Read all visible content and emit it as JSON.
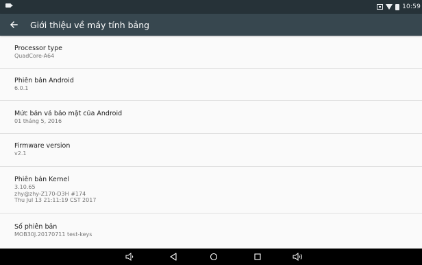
{
  "status_bar": {
    "time": "10:59",
    "icons": [
      "notification-icon",
      "sim-icon",
      "wifi-icon",
      "battery-icon"
    ]
  },
  "app_bar": {
    "back_icon": "arrow-back-icon",
    "title": "Giới thiệu về máy tính bảng"
  },
  "items": [
    {
      "title": "Processor type",
      "lines": [
        "QuadCore-A64"
      ]
    },
    {
      "title": "Phiên bản Android",
      "lines": [
        "6.0.1"
      ]
    },
    {
      "title": "Mức bản vá bảo mật của Android",
      "lines": [
        "01 tháng 5, 2016"
      ]
    },
    {
      "title": "Firmware version",
      "lines": [
        "v2.1"
      ]
    },
    {
      "title": "Phiên bản Kernel",
      "lines": [
        "3.10.65",
        "zhy@zhy-Z170-D3H #174",
        "Thu Jul 13 21:11:19 CST 2017"
      ]
    },
    {
      "title": "Số phiên bản",
      "lines": [
        "MOB30J.20170711 test-keys"
      ]
    }
  ],
  "nav_bar": {
    "buttons": [
      "volume-down-icon",
      "back-triangle-icon",
      "home-circle-icon",
      "recents-square-icon",
      "volume-up-icon"
    ]
  },
  "colors": {
    "status_bar": "#263238",
    "app_bar": "#37474f",
    "background": "#fafafa",
    "divider": "#e0e0e0",
    "nav_bar": "#000000"
  }
}
